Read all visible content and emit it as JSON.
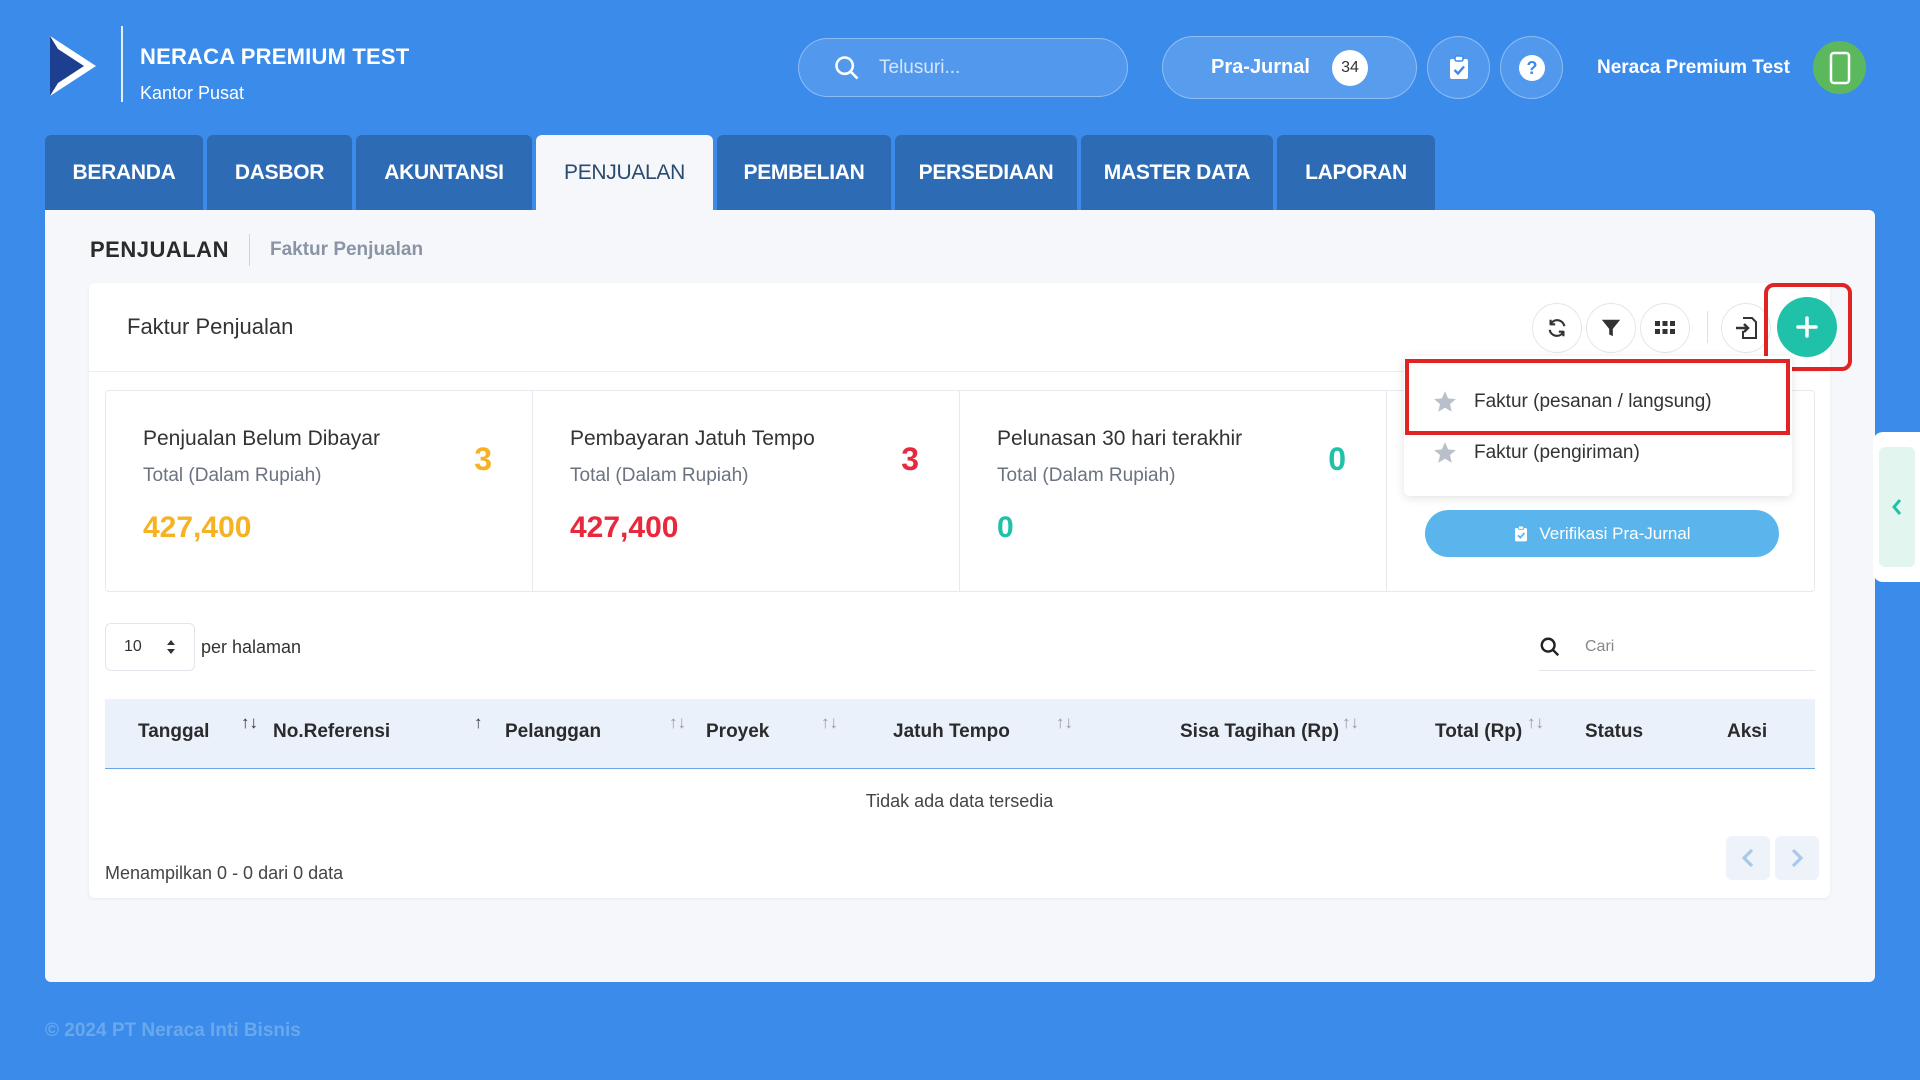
{
  "header": {
    "company_name": "NERACA PREMIUM TEST",
    "company_branch": "Kantor Pusat",
    "search_placeholder": "Telusuri...",
    "prajurnal_label": "Pra-Jurnal",
    "prajurnal_count": "34",
    "user_name": "Neraca Premium Test"
  },
  "nav": {
    "tabs": [
      {
        "label": "BERANDA"
      },
      {
        "label": "DASBOR"
      },
      {
        "label": "AKUNTANSI"
      },
      {
        "label": "PENJUALAN",
        "active": true
      },
      {
        "label": "PEMBELIAN"
      },
      {
        "label": "PERSEDIAAN"
      },
      {
        "label": "MASTER DATA"
      },
      {
        "label": "LAPORAN"
      }
    ]
  },
  "breadcrumb": {
    "main": "PENJUALAN",
    "sub": "Faktur Penjualan"
  },
  "card": {
    "title": "Faktur Penjualan",
    "verify_label": "Verifikasi Pra-Jurnal"
  },
  "stats": [
    {
      "title": "Penjualan Belum Dibayar",
      "subtitle": "Total (Dalam Rupiah)",
      "count": "3",
      "amount": "427,400",
      "color": "#f5b324"
    },
    {
      "title": "Pembayaran Jatuh Tempo",
      "subtitle": "Total (Dalam Rupiah)",
      "count": "3",
      "amount": "427,400",
      "color": "#e8283c"
    },
    {
      "title": "Pelunasan 30 hari terakhir",
      "subtitle": "Total (Dalam Rupiah)",
      "count": "0",
      "amount": "0",
      "color": "#1fc2a8"
    }
  ],
  "dropdown": {
    "items": [
      {
        "label": "Faktur (pesanan / langsung)"
      },
      {
        "label": "Faktur (pengiriman)"
      }
    ]
  },
  "table": {
    "per_page_value": "10",
    "per_page_label": "per halaman",
    "search_placeholder": "Cari",
    "columns": [
      "Tanggal",
      "No.Referensi",
      "Pelanggan",
      "Proyek",
      "Jatuh Tempo",
      "Sisa Tagihan (Rp)",
      "Total (Rp)",
      "Status",
      "Aksi"
    ],
    "empty_text": "Tidak ada data tersedia",
    "showing_text": "Menampilkan 0 - 0 dari 0 data"
  },
  "footer": {
    "copyright": "© 2024 PT Neraca Inti Bisnis"
  }
}
